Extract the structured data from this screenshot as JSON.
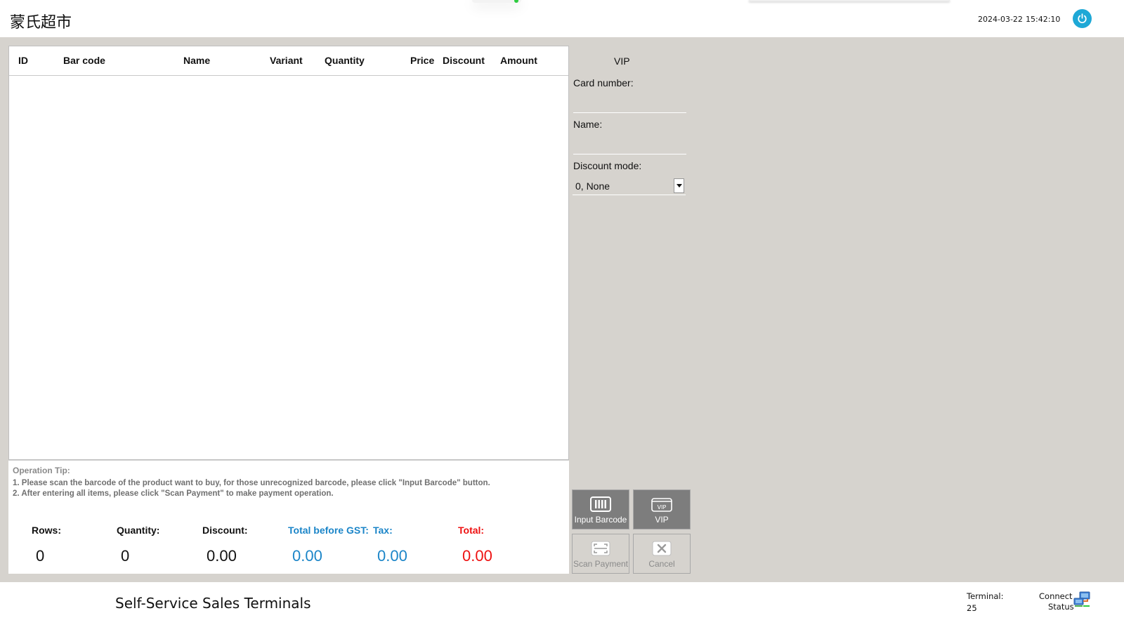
{
  "header": {
    "store_name": "蒙氏超市",
    "date": "2024-03-22",
    "time": "15:42:10",
    "power_icon": "power-icon",
    "accent_color": "#1ea8d6"
  },
  "table": {
    "columns": [
      "ID",
      "Bar code",
      "Name",
      "Variant",
      "Quantity",
      "Price",
      "Discount",
      "Amount"
    ],
    "rows": []
  },
  "tips": {
    "title": "Operation Tip:",
    "lines": [
      "1. Please scan the barcode of the product want to buy, for those unrecognized barcode, please click \"Input Barcode\" button.",
      "2. After entering all items, please click \"Scan Payment\" to make payment operation."
    ]
  },
  "summary": {
    "rows_label": "Rows:",
    "rows_value": "0",
    "quantity_label": "Quantity:",
    "quantity_value": "0",
    "discount_label": "Discount:",
    "discount_value": "0.00",
    "total_before_gst_label": "Total before GST:",
    "total_before_gst_value": "0.00",
    "tax_label": "Tax:",
    "tax_value": "0.00",
    "total_label": "Total:",
    "total_value": "0.00",
    "blue_color": "#1b85c8",
    "red_color": "#ee1111"
  },
  "vip": {
    "title": "VIP",
    "card_number_label": "Card number:",
    "name_label": "Name:",
    "discount_mode_label": "Discount mode:",
    "discount_mode_value": "0, None"
  },
  "buttons": {
    "input_barcode": "Input Barcode",
    "vip": "VIP",
    "scan_payment": "Scan Payment",
    "cancel": "Cancel"
  },
  "footer": {
    "title": "Self-Service Sales Terminals",
    "terminal_label": "Terminal:",
    "terminal_value": "25",
    "connect_label": "Connect",
    "status_label": "Status"
  }
}
